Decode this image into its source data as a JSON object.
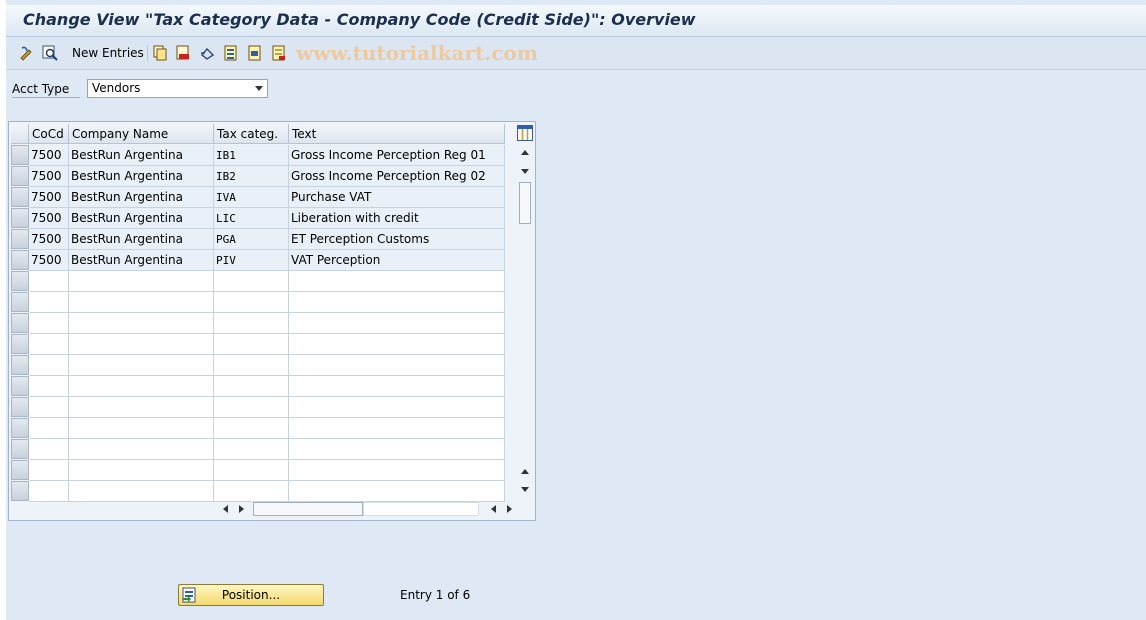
{
  "window": {
    "title": "Change View \"Tax Category Data - Company Code (Credit Side)\": Overview"
  },
  "toolbar": {
    "new_entries_label": "New Entries",
    "watermark": "www.tutorialkart.com",
    "icons": [
      "display-change-icon",
      "find-icon",
      "copy-icon",
      "delete-icon",
      "undo-icon",
      "select-all-icon",
      "select-block-icon",
      "deselect-all-icon"
    ]
  },
  "filter": {
    "label": "Acct Type",
    "value": "Vendors"
  },
  "table": {
    "columns": [
      "CoCd",
      "Company Name",
      "Tax categ.",
      "Text"
    ],
    "rows": [
      [
        "7500",
        "BestRun Argentina",
        "IB1",
        "Gross Income Perception Reg 01"
      ],
      [
        "7500",
        "BestRun Argentina",
        "IB2",
        "Gross Income Perception Reg 02"
      ],
      [
        "7500",
        "BestRun Argentina",
        "IVA",
        "Purchase VAT"
      ],
      [
        "7500",
        "BestRun Argentina",
        "LIC",
        "Liberation with credit"
      ],
      [
        "7500",
        "BestRun Argentina",
        "PGA",
        "ET Perception Customs"
      ],
      [
        "7500",
        "BestRun Argentina",
        "PIV",
        "VAT Perception"
      ]
    ]
  },
  "footer": {
    "position_label": "Position...",
    "entry_info": "Entry 1 of 6"
  }
}
